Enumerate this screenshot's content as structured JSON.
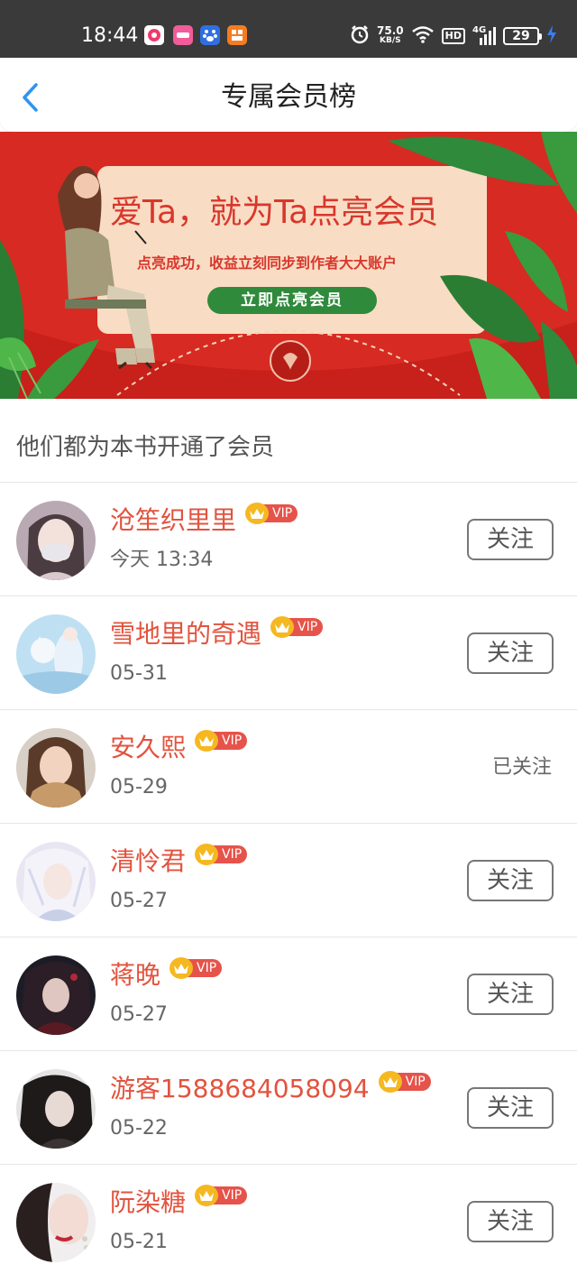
{
  "status_bar": {
    "time": "18:44",
    "net_speed": "75.0",
    "net_unit": "KB/S",
    "hd": "HD",
    "signal": "4G",
    "battery": "29",
    "app_icons": [
      "pink-app-icon",
      "magenta-app-icon",
      "baidu-icon",
      "orange-app-icon"
    ],
    "colors": {
      "background": "#3a3a3a"
    }
  },
  "nav": {
    "title": "专属会员榜",
    "back_icon": "chevron-left-icon",
    "back_color": "#2f94f0"
  },
  "banner": {
    "headline": "爱Ta，就为Ta点亮会员",
    "subtitle": "点亮成功，收益立刻同步到作者大大账户",
    "cta_label": "立即点亮会员",
    "colors": {
      "background": "#d72a22",
      "card": "#f9dcc4",
      "cta": "#2f8a3b",
      "text": "#d8372c"
    }
  },
  "section": {
    "title": "他们都为本书开通了会员"
  },
  "members": [
    {
      "name": "沧笙织里里",
      "vip": "VIP",
      "date": "今天 13:34",
      "follow_label": "关注",
      "followed": false
    },
    {
      "name": "雪地里的奇遇",
      "vip": "VIP",
      "date": "05-31",
      "follow_label": "关注",
      "followed": false
    },
    {
      "name": "安久熙",
      "vip": "VIP",
      "date": "05-29",
      "follow_label": "已关注",
      "followed": true
    },
    {
      "name": "清怜君",
      "vip": "VIP",
      "date": "05-27",
      "follow_label": "关注",
      "followed": false
    },
    {
      "name": "蒋晚",
      "vip": "VIP",
      "date": "05-27",
      "follow_label": "关注",
      "followed": false
    },
    {
      "name": "游客1588684058094",
      "vip": "VIP",
      "date": "05-22",
      "follow_label": "关注",
      "followed": false
    },
    {
      "name": "阮染糖",
      "vip": "VIP",
      "date": "05-21",
      "follow_label": "关注",
      "followed": false
    }
  ],
  "colors": {
    "name": "#e2533e",
    "vip_badge": "#e6534a",
    "crown": "#f5b820"
  }
}
